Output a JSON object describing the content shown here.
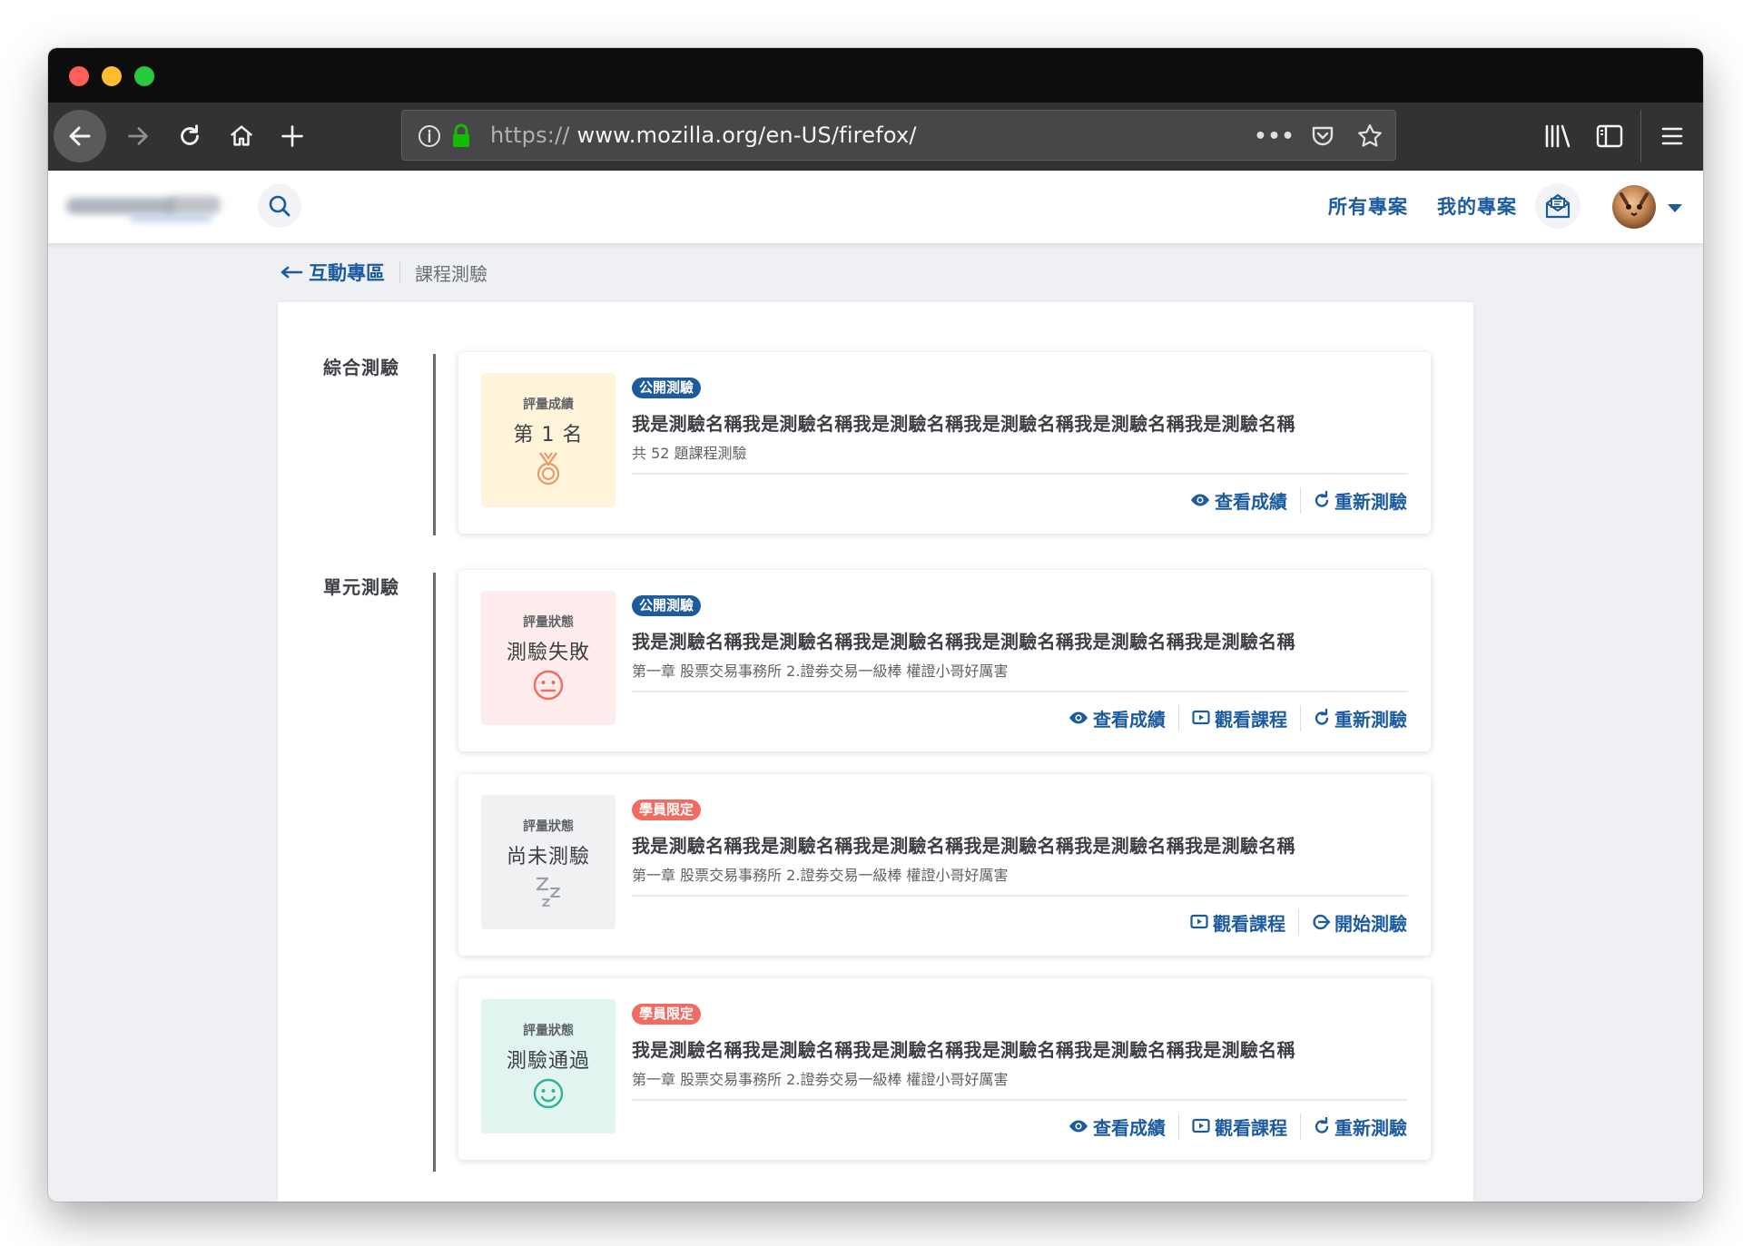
{
  "browser": {
    "url_protocol": "https://",
    "url_host_path": "www.mozilla.org/en-US/firefox/",
    "page_actions_label": "•••"
  },
  "header": {
    "nav_links": [
      "所有專案",
      "我的專案"
    ]
  },
  "breadcrumb": {
    "back_label": "互動專區",
    "current": "課程測驗"
  },
  "sections": [
    {
      "label": "綜合測驗"
    },
    {
      "label": "單元測驗"
    }
  ],
  "cards": [
    {
      "status_caption": "評量成績",
      "status_value": "第 1 名",
      "status_icon": "medal-icon",
      "status_bg": "#fff3da",
      "status_icon_color": "#e79a69",
      "badge": "公開測驗",
      "badge_color": "#1b5b9e",
      "title": "我是測驗名稱我是測驗名稱我是測驗名稱我是測驗名稱我是測驗名稱我是測驗名稱",
      "subtitle": "共 52 題課程測驗",
      "actions": [
        "查看成績",
        "重新測驗"
      ]
    },
    {
      "status_caption": "評量狀態",
      "status_value": "測驗失敗",
      "status_icon": "neutral-face-icon",
      "status_bg": "#fdeceb",
      "status_icon_color": "#f26b62",
      "badge": "公開測驗",
      "badge_color": "#1b5b9e",
      "title": "我是測驗名稱我是測驗名稱我是測驗名稱我是測驗名稱我是測驗名稱我是測驗名稱",
      "subtitle": "第一章 股票交易事務所 2.證劵交易一級棒 權證小哥好厲害",
      "actions": [
        "查看成績",
        "觀看課程",
        "重新測驗"
      ]
    },
    {
      "status_caption": "評量狀態",
      "status_value": "尚未測驗",
      "status_icon": "sleep-zzz-icon",
      "status_bg": "#f0f1f3",
      "status_icon_color": "#9a9da2",
      "badge": "學員限定",
      "badge_color": "#f26b62",
      "title": "我是測驗名稱我是測驗名稱我是測驗名稱我是測驗名稱我是測驗名稱我是測驗名稱",
      "subtitle": "第一章 股票交易事務所 2.證劵交易一級棒 權證小哥好厲害",
      "actions": [
        "觀看課程",
        "開始測驗"
      ]
    },
    {
      "status_caption": "評量狀態",
      "status_value": "測驗通過",
      "status_icon": "smile-face-icon",
      "status_bg": "#e1f4f0",
      "status_icon_color": "#2fb39a",
      "badge": "學員限定",
      "badge_color": "#f26b62",
      "title": "我是測驗名稱我是測驗名稱我是測驗名稱我是測驗名稱我是測驗名稱我是測驗名稱",
      "subtitle": "第一章 股票交易事務所 2.證劵交易一級棒 權證小哥好厲害",
      "actions": [
        "查看成績",
        "觀看課程",
        "重新測驗"
      ]
    }
  ]
}
